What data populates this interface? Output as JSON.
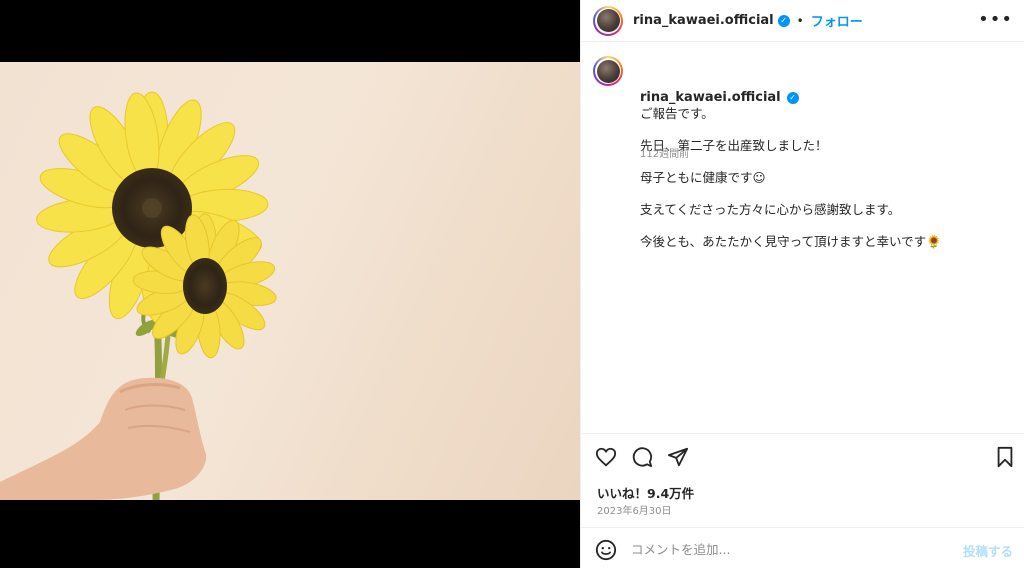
{
  "post": {
    "username": "rina_kawaei.official",
    "separator": "•",
    "follow_label": "フォロー",
    "more_icon": "more-options-icon",
    "caption_lines": [
      "ご報告です。",
      "先日、第二子を出産致しました！",
      "母子ともに健康です☺︎",
      "支えてくださった方々に心から感謝致します。",
      "今後とも、あたたかく見守って頂けますと幸いです🌻"
    ],
    "time_ago": "112週間前",
    "likes": "いいね！9.4万件",
    "date": "2023年6月30日",
    "comment_placeholder": "コメントを追加...",
    "post_label": "投稿する"
  },
  "icons": {
    "like": "heart-icon",
    "comment": "comment-icon",
    "share": "share-icon",
    "save": "bookmark-icon",
    "emoji": "emoji-icon",
    "verified": "verified-badge-icon"
  },
  "colors": {
    "accent": "#0095f6",
    "post_disabled": "#b2dffc",
    "secondary_text": "#8e8e8e"
  }
}
